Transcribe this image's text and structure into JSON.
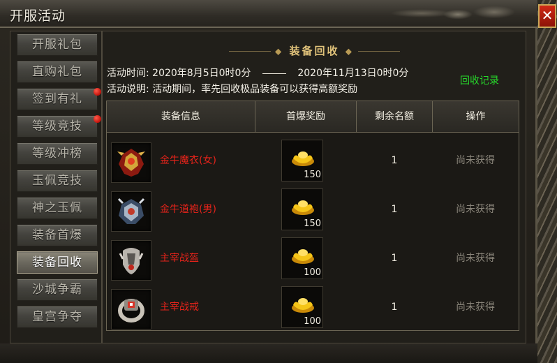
{
  "window": {
    "title": "开服活动",
    "close_icon": "close-icon"
  },
  "sidebar": {
    "items": [
      {
        "label": "开服礼包",
        "active": false,
        "badge": false
      },
      {
        "label": "直购礼包",
        "active": false,
        "badge": false
      },
      {
        "label": "签到有礼",
        "active": false,
        "badge": true
      },
      {
        "label": "等级竞技",
        "active": false,
        "badge": true
      },
      {
        "label": "等级冲榜",
        "active": false,
        "badge": false
      },
      {
        "label": "玉佩竞技",
        "active": false,
        "badge": false
      },
      {
        "label": "神之玉佩",
        "active": false,
        "badge": false
      },
      {
        "label": "装备首爆",
        "active": false,
        "badge": false
      },
      {
        "label": "装备回收",
        "active": true,
        "badge": false
      },
      {
        "label": "沙城争霸",
        "active": false,
        "badge": false
      },
      {
        "label": "皇宫争夺",
        "active": false,
        "badge": false
      }
    ]
  },
  "main": {
    "heading": "装备回收",
    "time_label": "活动时间:",
    "time_start": "2020年8月5日0时0分",
    "time_end": "2020年11月13日0时0分",
    "desc_label": "活动说明:",
    "desc_text": "活动期间，率先回收极品装备可以获得高额奖励",
    "record_link": "回收记录"
  },
  "table": {
    "headers": [
      "装备信息",
      "首爆奖励",
      "剩余名额",
      "操作"
    ],
    "rows": [
      {
        "name": "金牛魔衣(女)",
        "icon": "armor-female-icon",
        "reward_icon": "gold-ingot-icon",
        "reward": "150",
        "remaining": "1",
        "status": "尚未获得"
      },
      {
        "name": "金牛道袍(男)",
        "icon": "robe-male-icon",
        "reward_icon": "gold-ingot-icon",
        "reward": "150",
        "remaining": "1",
        "status": "尚未获得"
      },
      {
        "name": "主宰战盔",
        "icon": "helmet-icon",
        "reward_icon": "gold-ingot-icon",
        "reward": "100",
        "remaining": "1",
        "status": "尚未获得"
      },
      {
        "name": "主宰战戒",
        "icon": "ring-icon",
        "reward_icon": "gold-ingot-icon",
        "reward": "100",
        "remaining": "1",
        "status": "尚未获得"
      }
    ]
  },
  "colors": {
    "item_name": "#e8231a",
    "record_link": "#27d82b",
    "status": "#8a857a",
    "close_button": "#c0190c"
  }
}
